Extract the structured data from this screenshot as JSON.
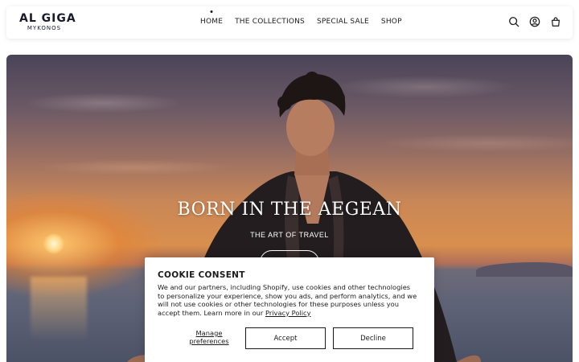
{
  "header": {
    "logo": {
      "main": "AL GIGA",
      "sub": "MYKONOS"
    },
    "nav": [
      {
        "label": "HOME",
        "active": true
      },
      {
        "label": "THE COLLECTIONS",
        "active": false
      },
      {
        "label": "SPECIAL SALE",
        "active": false
      },
      {
        "label": "SHOP",
        "active": false
      }
    ],
    "icons": [
      "search-icon",
      "account-icon",
      "cart-icon"
    ]
  },
  "hero": {
    "title": "BORN IN THE AEGEAN",
    "subtitle": "THE ART OF TRAVEL"
  },
  "cookie": {
    "title": "COOKIE CONSENT",
    "text": "We and our partners, including Shopify, use cookies and other technologies to personalize your experience, show you ads, and perform analytics, and we will not use cookies or other technologies for these purposes unless you accept them. Learn more in our ",
    "privacy_link": "Privacy Policy",
    "manage_label": "Manage preferences",
    "accept_label": "Accept",
    "decline_label": "Decline"
  },
  "colors": {
    "text": "#1b1b1b",
    "logo": "#1a1a2e",
    "header_bg": "#ffffff",
    "dialog_bg": "#ffffff"
  }
}
